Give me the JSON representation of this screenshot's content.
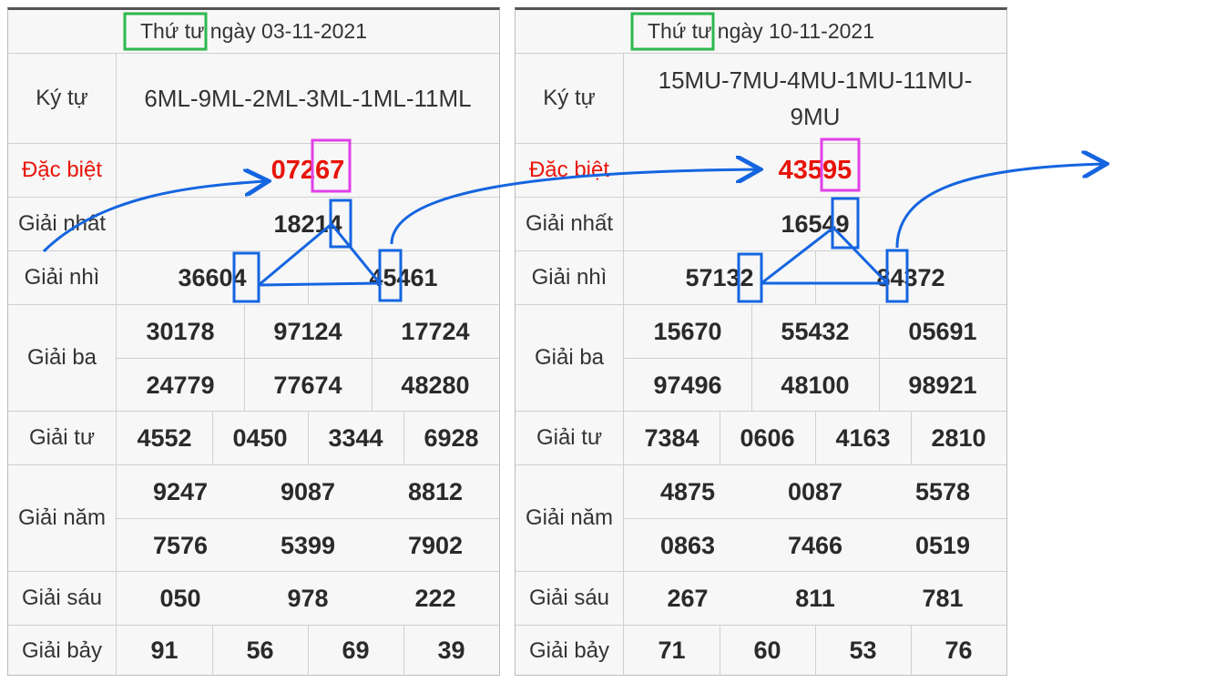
{
  "boards": [
    {
      "header": "Thứ tư ngày 03-11-2021",
      "code_label": "Ký tự",
      "code": "6ML-9ML-2ML-3ML-1ML-11ML",
      "special_label": "Đặc biệt",
      "special": "07267",
      "first_label": "Giải nhất",
      "first": "18214",
      "second_label": "Giải nhì",
      "second": [
        "36604",
        "45461"
      ],
      "third_label": "Giải ba",
      "third": [
        "30178",
        "97124",
        "17724",
        "24779",
        "77674",
        "48280"
      ],
      "fourth_label": "Giải tư",
      "fourth": [
        "4552",
        "0450",
        "3344",
        "6928"
      ],
      "fifth_label": "Giải năm",
      "fifth": [
        "9247",
        "9087",
        "8812",
        "7576",
        "5399",
        "7902"
      ],
      "sixth_label": "Giải sáu",
      "sixth": [
        "050",
        "978",
        "222"
      ],
      "seventh_label": "Giải bảy",
      "seventh": [
        "91",
        "56",
        "69",
        "39"
      ]
    },
    {
      "header": "Thứ tư ngày 10-11-2021",
      "code_label": "Ký tự",
      "code": "15MU-7MU-4MU-1MU-11MU-9MU",
      "special_label": "Đặc biệt",
      "special": "43595",
      "first_label": "Giải nhất",
      "first": "16549",
      "second_label": "Giải nhì",
      "second": [
        "57132",
        "84372"
      ],
      "third_label": "Giải ba",
      "third": [
        "15670",
        "55432",
        "05691",
        "97496",
        "48100",
        "98921"
      ],
      "fourth_label": "Giải tư",
      "fourth": [
        "7384",
        "0606",
        "4163",
        "2810"
      ],
      "fifth_label": "Giải năm",
      "fifth": [
        "4875",
        "0087",
        "5578",
        "0863",
        "7466",
        "0519"
      ],
      "sixth_label": "Giải sáu",
      "sixth": [
        "267",
        "811",
        "781"
      ],
      "seventh_label": "Giải bảy",
      "seventh": [
        "71",
        "60",
        "53",
        "76"
      ]
    }
  ],
  "colors": {
    "special": "#e8140a",
    "annotation_blue": "#1565e0",
    "annotation_green": "#2db84d",
    "annotation_magenta": "#e040e8"
  }
}
